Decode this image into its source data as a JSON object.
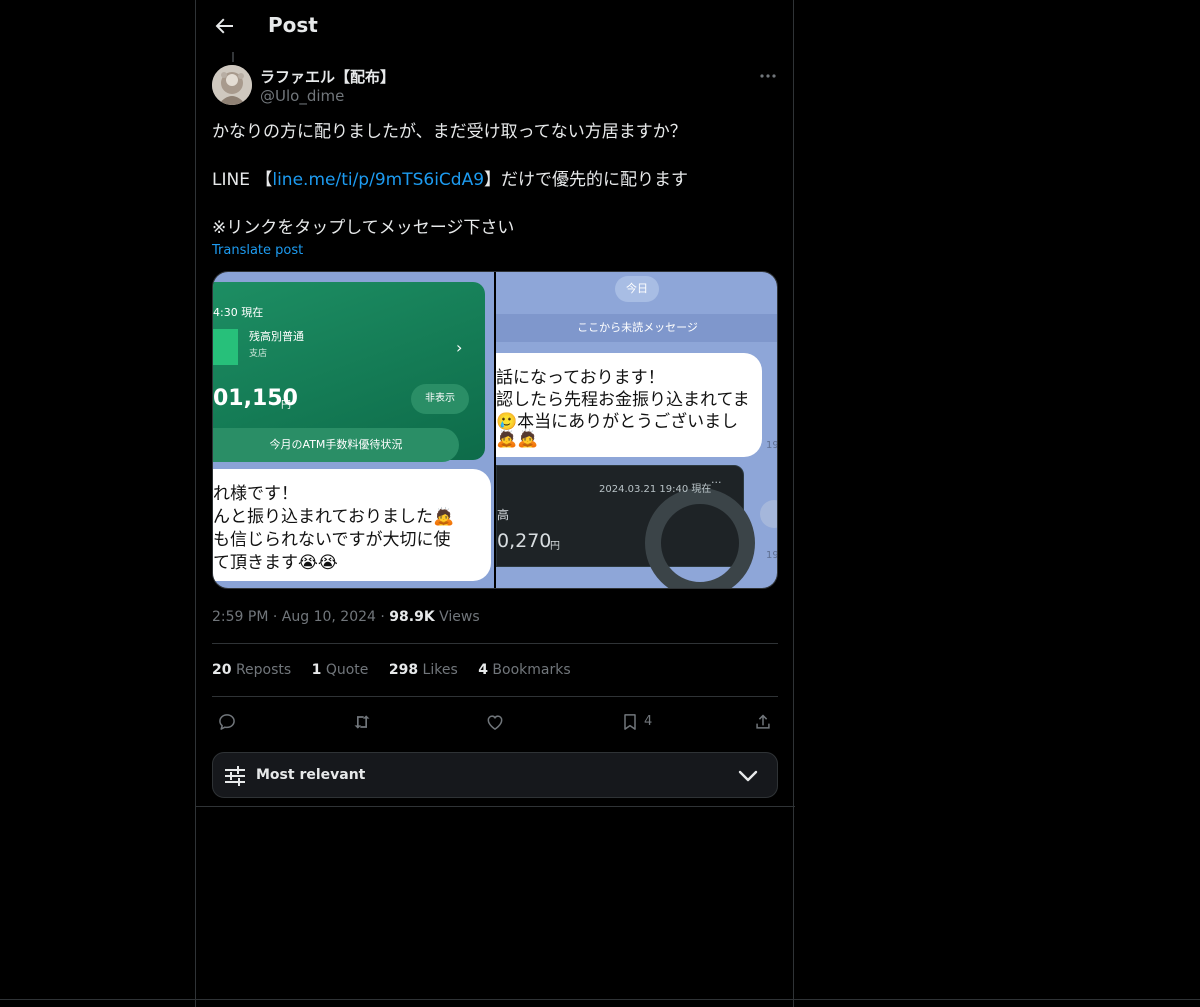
{
  "header": {
    "title": "Post"
  },
  "post": {
    "author_name": "ラファエル【配布】",
    "author_handle": "@Ulo_dime",
    "line1": "かなりの方に配りましたが、まだ受け取ってない方居ますか？",
    "line2_prefix": "LINE 【",
    "line2_link": "line.me/ti/p/9mTS6iCdA9",
    "line2_suffix": "】だけで優先的に配ります",
    "line3": "※リンクをタップしてメッセージ下さい",
    "translate": "Translate post",
    "time": "2:59 PM",
    "date": "Aug 10, 2024",
    "views": "98.9K",
    "views_label": "Views",
    "dot": "·"
  },
  "media": {
    "left": {
      "time_label": "4:30 現在",
      "account": "残高別普通",
      "branch": "支店",
      "amount": "01,150",
      "yen": "円",
      "hide_button": "非表示",
      "atm_button": "今月のATM手数料優待状況",
      "bubble": [
        "れ様です！",
        "んと振り込まれておりました🙇",
        "も信じられないですが大切に使",
        "て頂きます😭😭"
      ]
    },
    "right": {
      "today": "今日",
      "unread": "ここから未読メッセージ",
      "bubble": [
        "話になっております！",
        "認したら先程お金振り込まれてま",
        "🥲本当にありがとうございまし",
        "🙇🙇"
      ],
      "time1": "19",
      "card_date": "2024.03.21 19:40 現在",
      "card_dots": "···",
      "card_label": "高",
      "card_amount": "0,270",
      "card_yen": "円",
      "time2": "19:4"
    }
  },
  "stats": {
    "reposts_count": "20",
    "reposts_label": "Reposts",
    "quotes_count": "1",
    "quotes_label": "Quote",
    "likes_count": "298",
    "likes_label": "Likes",
    "bookmarks_count": "4",
    "bookmarks_label": "Bookmarks"
  },
  "actions": {
    "bookmark_count": "4"
  },
  "sort": {
    "label": "Most relevant"
  },
  "icons": {
    "back": "arrow-left-icon",
    "more": "more-horizontal-icon",
    "reply": "reply-icon",
    "repost": "repost-icon",
    "like": "heart-icon",
    "bookmark": "bookmark-icon",
    "share": "share-icon",
    "sort": "sliders-icon",
    "chevron": "chevron-down-icon"
  },
  "colors": {
    "background": "#000000",
    "text": "#e7e9ea",
    "muted": "#71767b",
    "link": "#1d9bf0",
    "border": "#2f3336"
  }
}
